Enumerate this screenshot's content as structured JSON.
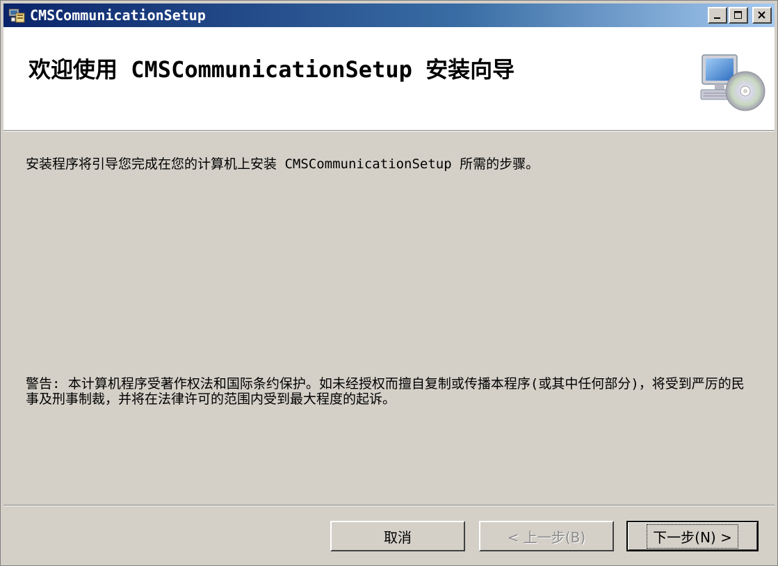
{
  "window": {
    "title": "CMSCommunicationSetup",
    "controls": {
      "minimize": "minimize-icon",
      "maximize": "maximize-icon",
      "close": "close-icon"
    }
  },
  "banner": {
    "title": "欢迎使用 CMSCommunicationSetup 安装向导",
    "icon": "computer-cd-icon"
  },
  "body": {
    "intro": "安装程序将引导您完成在您的计算机上安装 CMSCommunicationSetup 所需的步骤。",
    "warning": "警告: 本计算机程序受著作权法和国际条约保护。如未经授权而擅自复制或传播本程序(或其中任何部分)，将受到严厉的民事及刑事制裁，并将在法律许可的范围内受到最大程度的起诉。"
  },
  "buttons": {
    "cancel": "取消",
    "back": "< 上一步(B)",
    "next": "下一步(N) >"
  },
  "colors": {
    "titlebar_start": "#0a246a",
    "titlebar_end": "#a6caf0",
    "face": "#d4d0c8",
    "banner": "#ffffff"
  }
}
